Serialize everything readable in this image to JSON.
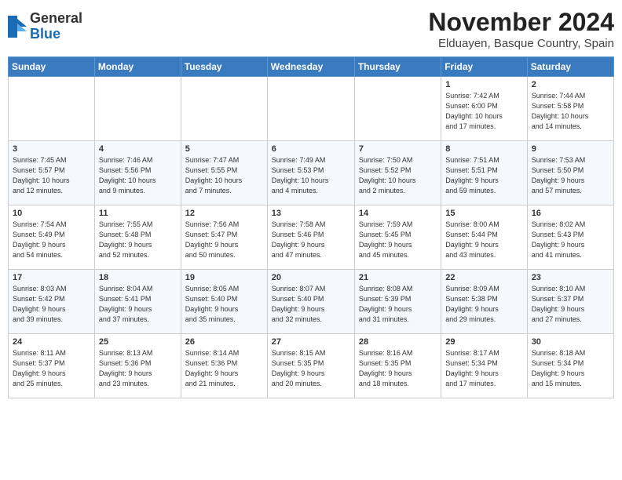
{
  "header": {
    "logo_general": "General",
    "logo_blue": "Blue",
    "title": "November 2024",
    "subtitle": "Elduayen, Basque Country, Spain"
  },
  "columns": [
    "Sunday",
    "Monday",
    "Tuesday",
    "Wednesday",
    "Thursday",
    "Friday",
    "Saturday"
  ],
  "weeks": [
    {
      "days": [
        {
          "num": "",
          "info": ""
        },
        {
          "num": "",
          "info": ""
        },
        {
          "num": "",
          "info": ""
        },
        {
          "num": "",
          "info": ""
        },
        {
          "num": "",
          "info": ""
        },
        {
          "num": "1",
          "info": "Sunrise: 7:42 AM\nSunset: 6:00 PM\nDaylight: 10 hours\nand 17 minutes."
        },
        {
          "num": "2",
          "info": "Sunrise: 7:44 AM\nSunset: 5:58 PM\nDaylight: 10 hours\nand 14 minutes."
        }
      ]
    },
    {
      "days": [
        {
          "num": "3",
          "info": "Sunrise: 7:45 AM\nSunset: 5:57 PM\nDaylight: 10 hours\nand 12 minutes."
        },
        {
          "num": "4",
          "info": "Sunrise: 7:46 AM\nSunset: 5:56 PM\nDaylight: 10 hours\nand 9 minutes."
        },
        {
          "num": "5",
          "info": "Sunrise: 7:47 AM\nSunset: 5:55 PM\nDaylight: 10 hours\nand 7 minutes."
        },
        {
          "num": "6",
          "info": "Sunrise: 7:49 AM\nSunset: 5:53 PM\nDaylight: 10 hours\nand 4 minutes."
        },
        {
          "num": "7",
          "info": "Sunrise: 7:50 AM\nSunset: 5:52 PM\nDaylight: 10 hours\nand 2 minutes."
        },
        {
          "num": "8",
          "info": "Sunrise: 7:51 AM\nSunset: 5:51 PM\nDaylight: 9 hours\nand 59 minutes."
        },
        {
          "num": "9",
          "info": "Sunrise: 7:53 AM\nSunset: 5:50 PM\nDaylight: 9 hours\nand 57 minutes."
        }
      ]
    },
    {
      "days": [
        {
          "num": "10",
          "info": "Sunrise: 7:54 AM\nSunset: 5:49 PM\nDaylight: 9 hours\nand 54 minutes."
        },
        {
          "num": "11",
          "info": "Sunrise: 7:55 AM\nSunset: 5:48 PM\nDaylight: 9 hours\nand 52 minutes."
        },
        {
          "num": "12",
          "info": "Sunrise: 7:56 AM\nSunset: 5:47 PM\nDaylight: 9 hours\nand 50 minutes."
        },
        {
          "num": "13",
          "info": "Sunrise: 7:58 AM\nSunset: 5:46 PM\nDaylight: 9 hours\nand 47 minutes."
        },
        {
          "num": "14",
          "info": "Sunrise: 7:59 AM\nSunset: 5:45 PM\nDaylight: 9 hours\nand 45 minutes."
        },
        {
          "num": "15",
          "info": "Sunrise: 8:00 AM\nSunset: 5:44 PM\nDaylight: 9 hours\nand 43 minutes."
        },
        {
          "num": "16",
          "info": "Sunrise: 8:02 AM\nSunset: 5:43 PM\nDaylight: 9 hours\nand 41 minutes."
        }
      ]
    },
    {
      "days": [
        {
          "num": "17",
          "info": "Sunrise: 8:03 AM\nSunset: 5:42 PM\nDaylight: 9 hours\nand 39 minutes."
        },
        {
          "num": "18",
          "info": "Sunrise: 8:04 AM\nSunset: 5:41 PM\nDaylight: 9 hours\nand 37 minutes."
        },
        {
          "num": "19",
          "info": "Sunrise: 8:05 AM\nSunset: 5:40 PM\nDaylight: 9 hours\nand 35 minutes."
        },
        {
          "num": "20",
          "info": "Sunrise: 8:07 AM\nSunset: 5:40 PM\nDaylight: 9 hours\nand 32 minutes."
        },
        {
          "num": "21",
          "info": "Sunrise: 8:08 AM\nSunset: 5:39 PM\nDaylight: 9 hours\nand 31 minutes."
        },
        {
          "num": "22",
          "info": "Sunrise: 8:09 AM\nSunset: 5:38 PM\nDaylight: 9 hours\nand 29 minutes."
        },
        {
          "num": "23",
          "info": "Sunrise: 8:10 AM\nSunset: 5:37 PM\nDaylight: 9 hours\nand 27 minutes."
        }
      ]
    },
    {
      "days": [
        {
          "num": "24",
          "info": "Sunrise: 8:11 AM\nSunset: 5:37 PM\nDaylight: 9 hours\nand 25 minutes."
        },
        {
          "num": "25",
          "info": "Sunrise: 8:13 AM\nSunset: 5:36 PM\nDaylight: 9 hours\nand 23 minutes."
        },
        {
          "num": "26",
          "info": "Sunrise: 8:14 AM\nSunset: 5:36 PM\nDaylight: 9 hours\nand 21 minutes."
        },
        {
          "num": "27",
          "info": "Sunrise: 8:15 AM\nSunset: 5:35 PM\nDaylight: 9 hours\nand 20 minutes."
        },
        {
          "num": "28",
          "info": "Sunrise: 8:16 AM\nSunset: 5:35 PM\nDaylight: 9 hours\nand 18 minutes."
        },
        {
          "num": "29",
          "info": "Sunrise: 8:17 AM\nSunset: 5:34 PM\nDaylight: 9 hours\nand 17 minutes."
        },
        {
          "num": "30",
          "info": "Sunrise: 8:18 AM\nSunset: 5:34 PM\nDaylight: 9 hours\nand 15 minutes."
        }
      ]
    }
  ]
}
